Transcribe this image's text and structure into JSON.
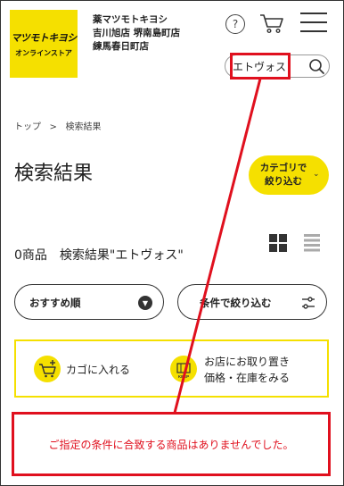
{
  "header": {
    "logo_text": "マツモトキヨシ",
    "logo_subtext": "オンラインストア",
    "store_lines": [
      "薬マツモトキヨシ",
      "吉川旭店 堺南島町店",
      "練馬春日町店"
    ],
    "help_icon": "?"
  },
  "search": {
    "value": "エトヴォス",
    "icon": "search-icon"
  },
  "breadcrumb": {
    "items": [
      "トップ",
      ">",
      "検索結果"
    ]
  },
  "page": {
    "title": "検索結果",
    "category_button": [
      "カテゴリで",
      "絞り込む"
    ],
    "category_chevron": "⌄",
    "result_count": "0商品　検索結果\"エトヴォス\""
  },
  "controls": {
    "sort_label": "おすすめ順",
    "sort_arrow": "▼",
    "filter_label": "条件で絞り込む"
  },
  "info": {
    "cart_label": "カゴに入れる",
    "keep_lines": [
      "お店にお取り置き",
      "価格・在庫をみる"
    ],
    "keep_badge": "KEEP"
  },
  "message": {
    "no_results": "ご指定の条件に合致する商品はありませんでした。"
  },
  "colors": {
    "accent": "#f5e000",
    "highlight": "#e0101e",
    "text": "#222222"
  }
}
